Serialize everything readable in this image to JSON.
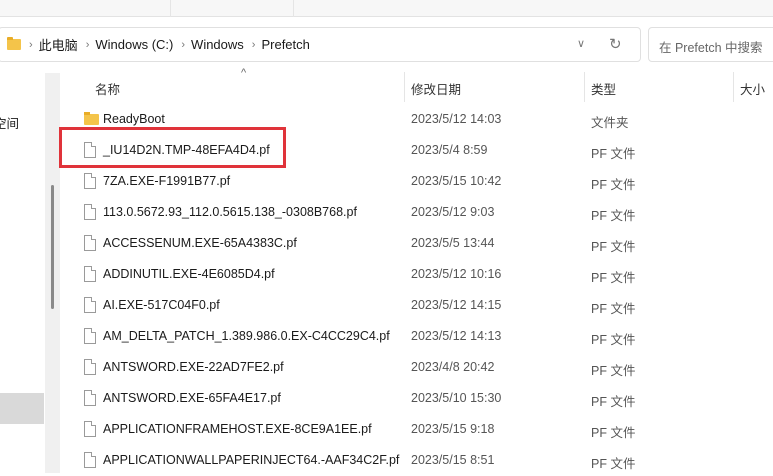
{
  "breadcrumb": [
    "此电脑",
    "Windows (C:)",
    "Windows",
    "Prefetch"
  ],
  "search": {
    "placeholder": "在 Prefetch 中搜索"
  },
  "sidebar": {
    "partial_item": "空间"
  },
  "columns": {
    "name": "名称",
    "date": "修改日期",
    "type": "类型",
    "size": "大小"
  },
  "files": [
    {
      "name": "ReadyBoot",
      "date": "2023/5/12 14:03",
      "type": "文件夹",
      "icon": "folder"
    },
    {
      "name": "_IU14D2N.TMP-48EFA4D4.pf",
      "date": "2023/5/4 8:59",
      "type": "PF 文件",
      "icon": "file",
      "highlighted": true
    },
    {
      "name": "7ZA.EXE-F1991B77.pf",
      "date": "2023/5/15 10:42",
      "type": "PF 文件",
      "icon": "file"
    },
    {
      "name": "113.0.5672.93_112.0.5615.138_-0308B768.pf",
      "date": "2023/5/12 9:03",
      "type": "PF 文件",
      "icon": "file"
    },
    {
      "name": "ACCESSENUM.EXE-65A4383C.pf",
      "date": "2023/5/5 13:44",
      "type": "PF 文件",
      "icon": "file"
    },
    {
      "name": "ADDINUTIL.EXE-4E6085D4.pf",
      "date": "2023/5/12 10:16",
      "type": "PF 文件",
      "icon": "file"
    },
    {
      "name": "AI.EXE-517C04F0.pf",
      "date": "2023/5/12 14:15",
      "type": "PF 文件",
      "icon": "file"
    },
    {
      "name": "AM_DELTA_PATCH_1.389.986.0.EX-C4CC29C4.pf",
      "date": "2023/5/12 14:13",
      "type": "PF 文件",
      "icon": "file"
    },
    {
      "name": "ANTSWORD.EXE-22AD7FE2.pf",
      "date": "2023/4/8 20:42",
      "type": "PF 文件",
      "icon": "file"
    },
    {
      "name": "ANTSWORD.EXE-65FA4E17.pf",
      "date": "2023/5/10 15:30",
      "type": "PF 文件",
      "icon": "file"
    },
    {
      "name": "APPLICATIONFRAMEHOST.EXE-8CE9A1EE.pf",
      "date": "2023/5/15 9:18",
      "type": "PF 文件",
      "icon": "file"
    },
    {
      "name": "APPLICATIONWALLPAPERINJECT64.-AAF34C2F.pf",
      "date": "2023/5/15 8:51",
      "type": "PF 文件",
      "icon": "file"
    }
  ],
  "colors": {
    "highlight": "#e0333a",
    "folder": "#f4c44a"
  }
}
